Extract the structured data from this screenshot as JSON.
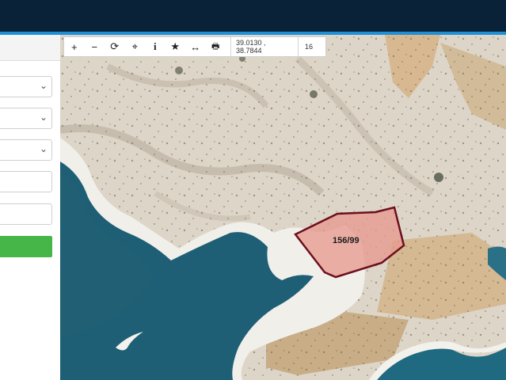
{
  "toolbar": {
    "zoom_in": "+",
    "zoom_out": "−",
    "refresh": "⟳",
    "locate": "⌖",
    "info": "i",
    "favorite": "★",
    "measure": "↔",
    "print": "🖶",
    "coordinates": "39.0130 , 38.7844",
    "zoom_level": "16"
  },
  "map": {
    "parcel_label": "156/99",
    "parcel_fill": "#e79a8f",
    "parcel_stroke": "#6d0f1e",
    "water_color": "#1e5f76"
  },
  "colors": {
    "topbar": "#0a2238",
    "accent_line": "#1f8fd6",
    "primary_button": "#46b649"
  }
}
